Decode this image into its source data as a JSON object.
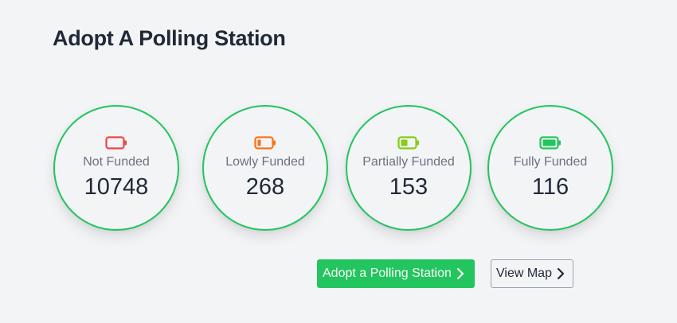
{
  "page": {
    "title": "Adopt A Polling Station"
  },
  "stats": [
    {
      "label": "Not Funded",
      "count": "10748",
      "color": "#ef4444",
      "fill": 0,
      "icon": "battery-empty-icon"
    },
    {
      "label": "Lowly Funded",
      "count": "268",
      "color": "#f97316",
      "fill": 0.25,
      "icon": "battery-low-icon"
    },
    {
      "label": "Partially Funded",
      "count": "153",
      "color": "#84cc16",
      "fill": 0.5,
      "icon": "battery-half-icon"
    },
    {
      "label": "Fully Funded",
      "count": "116",
      "color": "#22c55e",
      "fill": 1,
      "icon": "battery-full-icon"
    }
  ],
  "actions": {
    "adopt_label": "Adopt a Polling Station",
    "map_label": "View Map"
  },
  "colors": {
    "accent": "#22c55e",
    "background": "#f3f4f6"
  }
}
